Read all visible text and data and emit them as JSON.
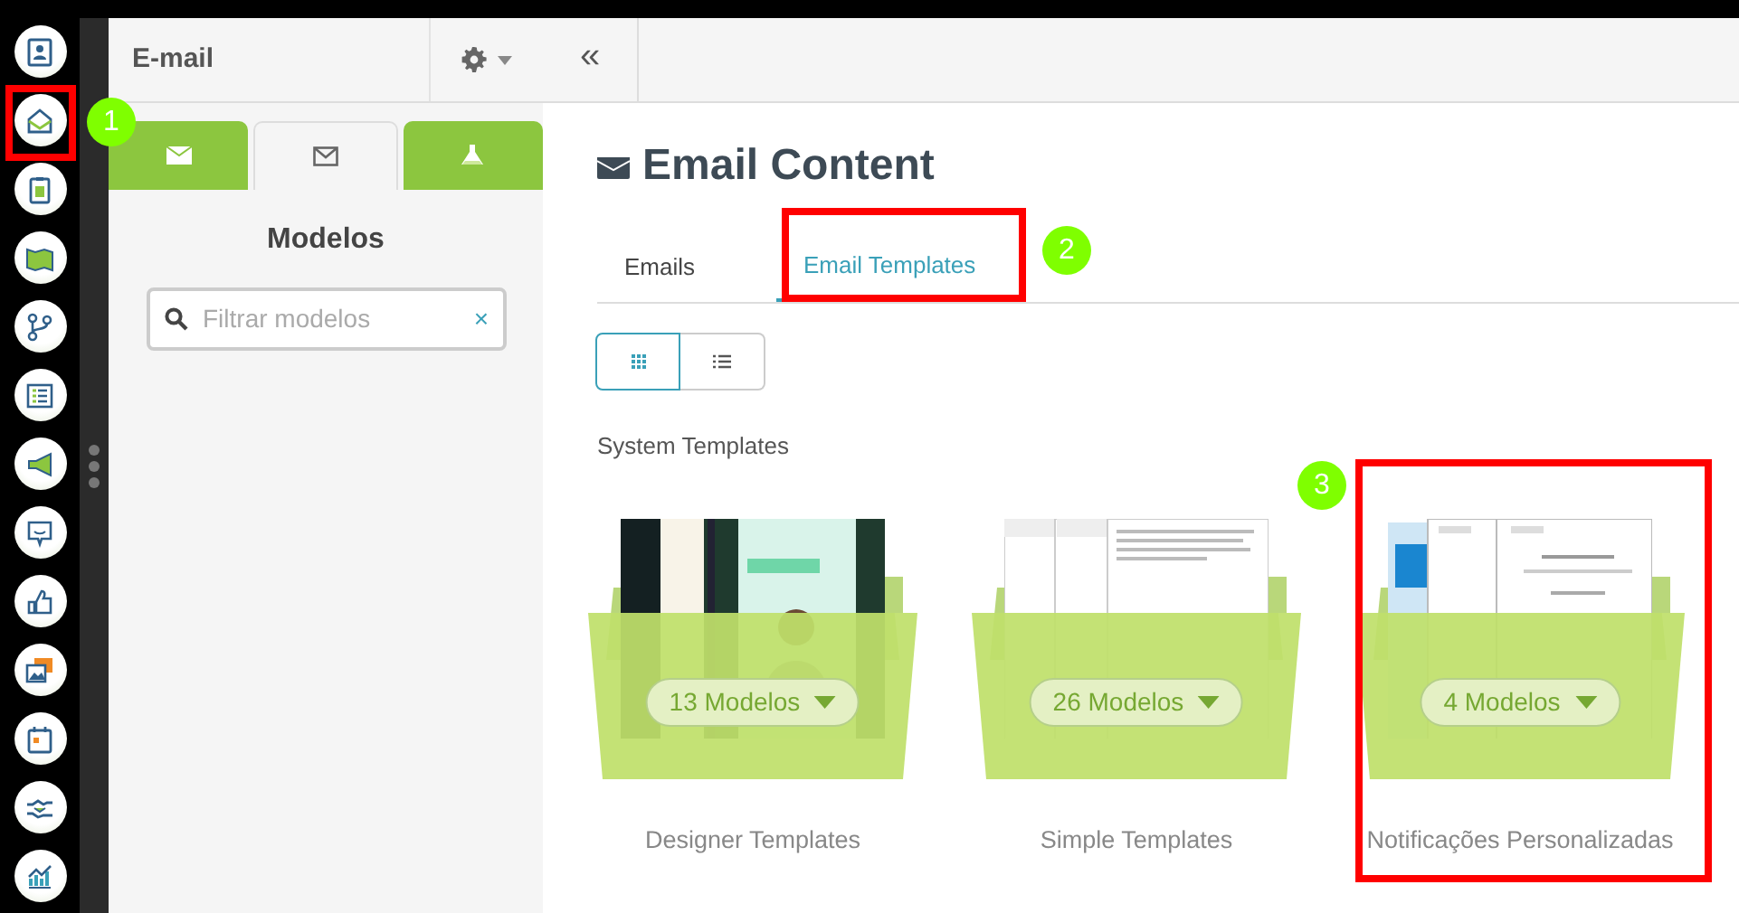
{
  "panel": {
    "title": "E-mail",
    "tabs": [
      {
        "selected": false
      },
      {
        "selected": true
      },
      {
        "selected": false
      }
    ],
    "heading": "Modelos",
    "search": {
      "placeholder": "Filtrar modelos",
      "clear": "×"
    }
  },
  "collapse": "«",
  "content": {
    "title": "Email Content",
    "tabs": [
      {
        "label": "Emails",
        "selected": false
      },
      {
        "label": "Email Templates",
        "selected": true
      }
    ],
    "views": [
      {
        "kind": "grid",
        "selected": true
      },
      {
        "kind": "list",
        "selected": false
      }
    ],
    "section": "System Templates",
    "folders": [
      {
        "count": "13 Modelos",
        "name": "Designer Templates",
        "kind": "picture"
      },
      {
        "count": "26 Modelos",
        "name": "Simple Templates",
        "kind": "picture"
      },
      {
        "count": "4 Modelos",
        "name": "Notificações Personalizadas",
        "kind": "picture"
      }
    ]
  },
  "annotations": [
    {
      "number": "1"
    },
    {
      "number": "2"
    },
    {
      "number": "3"
    }
  ]
}
